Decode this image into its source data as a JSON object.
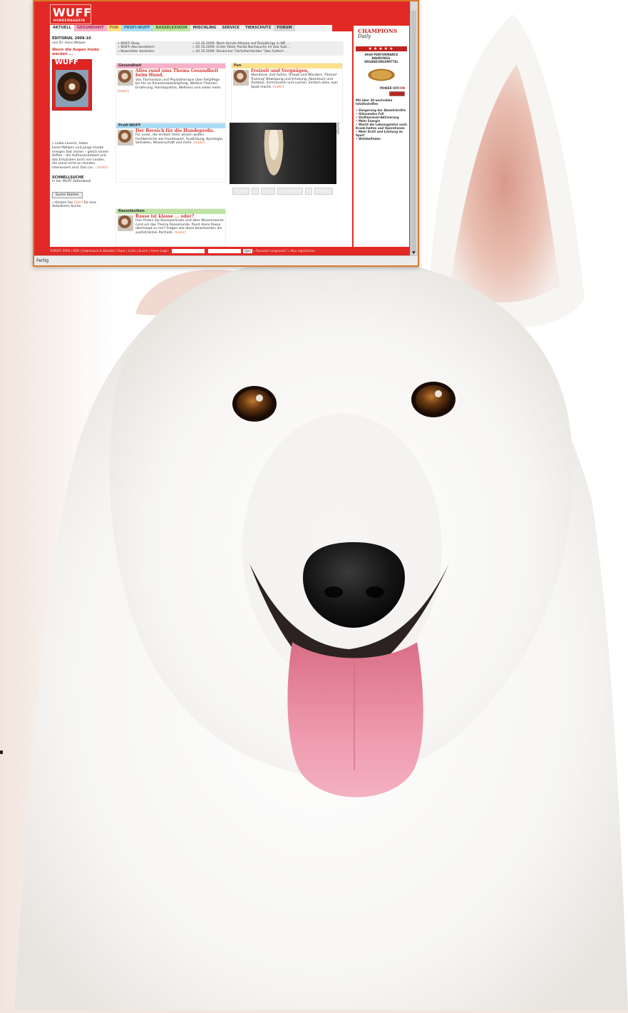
{
  "site": {
    "logo": "WUFF",
    "logo_sub": "HUNDEMAGAZIN",
    "nav": [
      "AKTUELL",
      "GESUNDHEIT",
      "FUN",
      "PROFI-WUFF",
      "RASSELEXIKON",
      "MISCHLING",
      "SERVICE",
      "TIERSCHUTZ",
      "FORUM"
    ]
  },
  "left": {
    "editorial_title": "EDITORIAL 2009-10",
    "editorial_author": "von Dr. Hans Mosser",
    "headline": "Wenn die Augen müde werden ...",
    "magazine_logo": "WUFF",
    "body": "» Liebe Leserin, lieber Leser!Welpen und junge Hunde erregen fast immer – gleich einem Reflex – die Aufmerksamkeit und das Entzücken auch von Leuten, die sonst nicht an Hunden interessiert sind. Das Lor...",
    "more": "[mehr]",
    "quick_search_title": "SCHNELLSUCHE",
    "quick_search_sub": "in der WUFF-Datenbank",
    "search_button": "Suche Starten",
    "click_text_1": "» Klicken Sie",
    "click_link": "[hier]",
    "click_text_2": "für eine detaillierte Suche."
  },
  "top_links": {
    "col1": [
      "» WUFF-Shop",
      "» WUFF-Abo bestellen!",
      "» Newsletter bestellen"
    ],
    "col2": [
      "» 22.10.2009: Nach Hunde-Attacke auf Dreijährige in NÖ ...",
      "» 20.10.2009: Erster Roter Panda Nachwuchs im Zoo Salz ...",
      "» 20.10.2009: Deutscher Tierfutterhändler \"Das Futterh ..."
    ]
  },
  "boxes": {
    "gesundheit": {
      "header": "Gesundheit",
      "title": "Alles rund ums Thema Gesundheit beim Hund.",
      "text": "Von Tiermedizin und Physiotherapie über Fellpflege bis hin zu Parasitenbekämpfung. Weitere Themen: Ernährung, Homöopathie, Wellness und vieles mehr.",
      "more": "[mehr]"
    },
    "fun": {
      "header": "Fun",
      "title": "Freizeit und Vergnügen,",
      "text": "Abenteuer und Action, Urlaub und Wandern, Fitness! Training! Bewegung und Erholung, Abenteuer und Outdoor, Schmunzeln und Lachen. Einfach alles, was Spaß macht.",
      "more": "[mehr]"
    },
    "profi": {
      "header": "Profi-WUFF",
      "title": "Der Bereich für die Hundeprofis.",
      "text": "Für Leser, die einfach mehr wissen wollen. Fachbereiche wie Hundesport, Ausbildung, Kynologie, Verhalten, Wissenschaft und mehr.",
      "more": "[mehr]"
    },
    "rasse": {
      "header": "Rasselexikon",
      "title": "Rasse ist klasse ... oder?",
      "text": "Hier finden Sie Rasseportraits und alles Wissenswerte rund um das Thema Rassehunde. Passt diese Rasse überhaupt zu mir? Fragen wie diese beantworten die ausführlichen Portraits.",
      "more": "[mehr]"
    }
  },
  "video_side_label": "Anzeige",
  "ad": {
    "brand_1": "CHAMPIONS",
    "brand_2": "Daily",
    "stars": "★★★★★",
    "claim_1": "HIGH PERFORMANCE",
    "claim_2": "NAHRUNGS-",
    "claim_3": "ERGÄNZUNGSMITTEL",
    "power_label": "POWER OFF/",
    "power_on": "ON",
    "list_head": "Mit über 30 wertvollen Inhaltsstoffen",
    "items": [
      "Steigerung der Abwehrkräfte",
      "Glänzendes Fell",
      "Stoffwechsel-Aktivierung",
      "Mehr Energie",
      "Wacht die Lebensgeister nach Krank-heiten und Operationen",
      "Mehr Kraft und Leistung im Sport",
      "Wohlbefinden"
    ]
  },
  "footer": {
    "text": "©WUFF 2009 | AGB | Impressum & Kontakt | Team | Links | Suche | Foren-Login:",
    "go": "[go]",
    "after": "» Passwort vergessen? » Neu registrieren"
  },
  "browser": {
    "status": "Fertig"
  },
  "colors": {
    "brand_red": "#e12a25",
    "window_border": "#d97a2b"
  }
}
